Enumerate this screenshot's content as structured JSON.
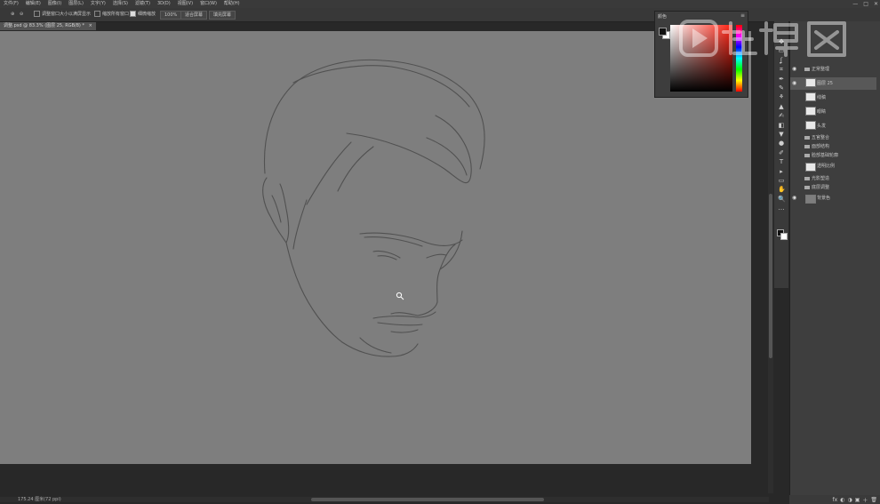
{
  "menu": [
    "文件(F)",
    "编辑(E)",
    "图像(I)",
    "图层(L)",
    "文字(Y)",
    "选择(S)",
    "滤镜(T)",
    "3D(D)",
    "视图(V)",
    "窗口(W)",
    "帮助(H)"
  ],
  "window_controls": [
    "—",
    "□",
    "✕"
  ],
  "options": {
    "zoom_in": "⊕",
    "zoom_out": "⊖",
    "resize_windows": "调整窗口大小以满屏显示",
    "zoom_all": "缩放所有窗口",
    "scrubby_zoom": "细微缩放",
    "zoom_percent": "100%",
    "fit_screen": "适合屏幕",
    "fill_screen": "填充屏幕"
  },
  "doc_tab": {
    "title": "调整.psd @ 83.3% (图层 25, RGB/8) *",
    "close": "×"
  },
  "status": "175.24 厘米(72 ppi)",
  "color_panel": {
    "title": "颜色",
    "menu": "≡",
    "foreground": "#111111",
    "background": "#ffffff",
    "hue": "#ff2010"
  },
  "layers": [
    {
      "label": "正常整理",
      "kind": "folder",
      "eye": true
    },
    {
      "label": "图层 25",
      "kind": "layer",
      "eye": true,
      "selected": true
    },
    {
      "label": "线稿",
      "kind": "layer",
      "eye": false
    },
    {
      "label": "眼睛",
      "kind": "layer",
      "eye": false
    },
    {
      "label": "头发",
      "kind": "layer",
      "eye": false
    },
    {
      "label": "五官整合",
      "kind": "folder",
      "eye": false
    },
    {
      "label": "面部结构",
      "kind": "folder",
      "eye": false
    },
    {
      "label": "脸部基础轮廓",
      "kind": "folder",
      "eye": false
    },
    {
      "label": "透明比例",
      "kind": "layer",
      "eye": false
    },
    {
      "label": "光影塑造",
      "kind": "folder",
      "eye": false
    },
    {
      "label": "底层调整",
      "kind": "folder",
      "eye": false
    },
    {
      "label": "背景色",
      "kind": "layer",
      "eye": true
    }
  ],
  "layer_buttons": [
    "fx",
    "◐",
    "◑",
    "▣",
    "＋",
    "🗑"
  ],
  "tools": [
    "✥",
    "▭",
    "ʆ",
    "⌗",
    "✒",
    "✎",
    "⚘",
    "▲",
    "✍",
    "◧",
    "▼",
    "●",
    "✐",
    "T",
    "▸",
    "▭",
    "✋",
    "🔍",
    "…"
  ],
  "canvas_bg": "#7e7e7e"
}
